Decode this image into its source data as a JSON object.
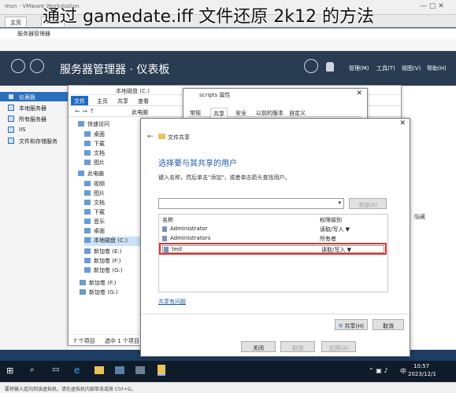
{
  "caption": "通过 gamedate.iff 文件还原 2k12 的方法",
  "vm": {
    "title": "mon - VMware Workstation",
    "tabs": [
      "主页",
      "mon"
    ]
  },
  "server_manager": {
    "title": "服务器管理器",
    "banner_title": "服务器管理器 · 仪表板",
    "menu": [
      "管理(M)",
      "工具(T)",
      "视图(V)",
      "帮助(H)"
    ],
    "sidebar": [
      "仪表板",
      "本地服务器",
      "所有服务器",
      "IIS",
      "文件和存储服务"
    ],
    "right_labels": [
      "隐藏",
      "隐藏"
    ]
  },
  "explorer": {
    "title": "本地磁盘 (C:)",
    "ribbon_tabs": [
      "文件",
      "主页",
      "共享",
      "查看"
    ],
    "address_prefix": "此电脑",
    "tree": [
      "快速访问",
      "桌面",
      "下载",
      "文档",
      "图片",
      "此电脑",
      "视频",
      "图片",
      "文档",
      "下载",
      "音乐",
      "桌面",
      "本地磁盘 (C:)",
      "新加卷 (E:)",
      "新加卷 (F:)",
      "新加卷 (G:)",
      "新加卷 (F:)",
      "新加卷 (G:)"
    ],
    "status_left": "7 个项目",
    "status_right": "选中 1 个项目"
  },
  "properties": {
    "title": "scripts 属性",
    "tabs": [
      "常规",
      "共享",
      "安全",
      "以前的版本",
      "自定义"
    ],
    "buttons": [
      "关闭",
      "取消",
      "应用(A)"
    ]
  },
  "share": {
    "title": "文件共享",
    "heading": "选择要与其共享的用户",
    "instruction": "键入名称，然后单击\"添加\"，或者单击箭头查找用户。",
    "add_button": "添加(A)",
    "col_name": "名称",
    "col_perm": "权限级别",
    "rows": [
      {
        "name": "Administrator",
        "perm": "读取/写入 ▼"
      },
      {
        "name": "Administrators",
        "perm": "所有者"
      },
      {
        "name": "test",
        "perm": "读取/写入 ▼"
      }
    ],
    "help_link": "共享有问题",
    "share_button": "共享(H)",
    "cancel_button": "取消"
  },
  "taskbar": {
    "time": "10:57",
    "date": "2023/12/1",
    "lang": "中"
  },
  "status_bar": "要将输入定向到该虚拟机，请在虚拟机内部单击或按 Ctrl+G。",
  "colors": {
    "banner": "#2a3c51",
    "accent": "#2a6fbe",
    "highlight": "#e03030"
  }
}
